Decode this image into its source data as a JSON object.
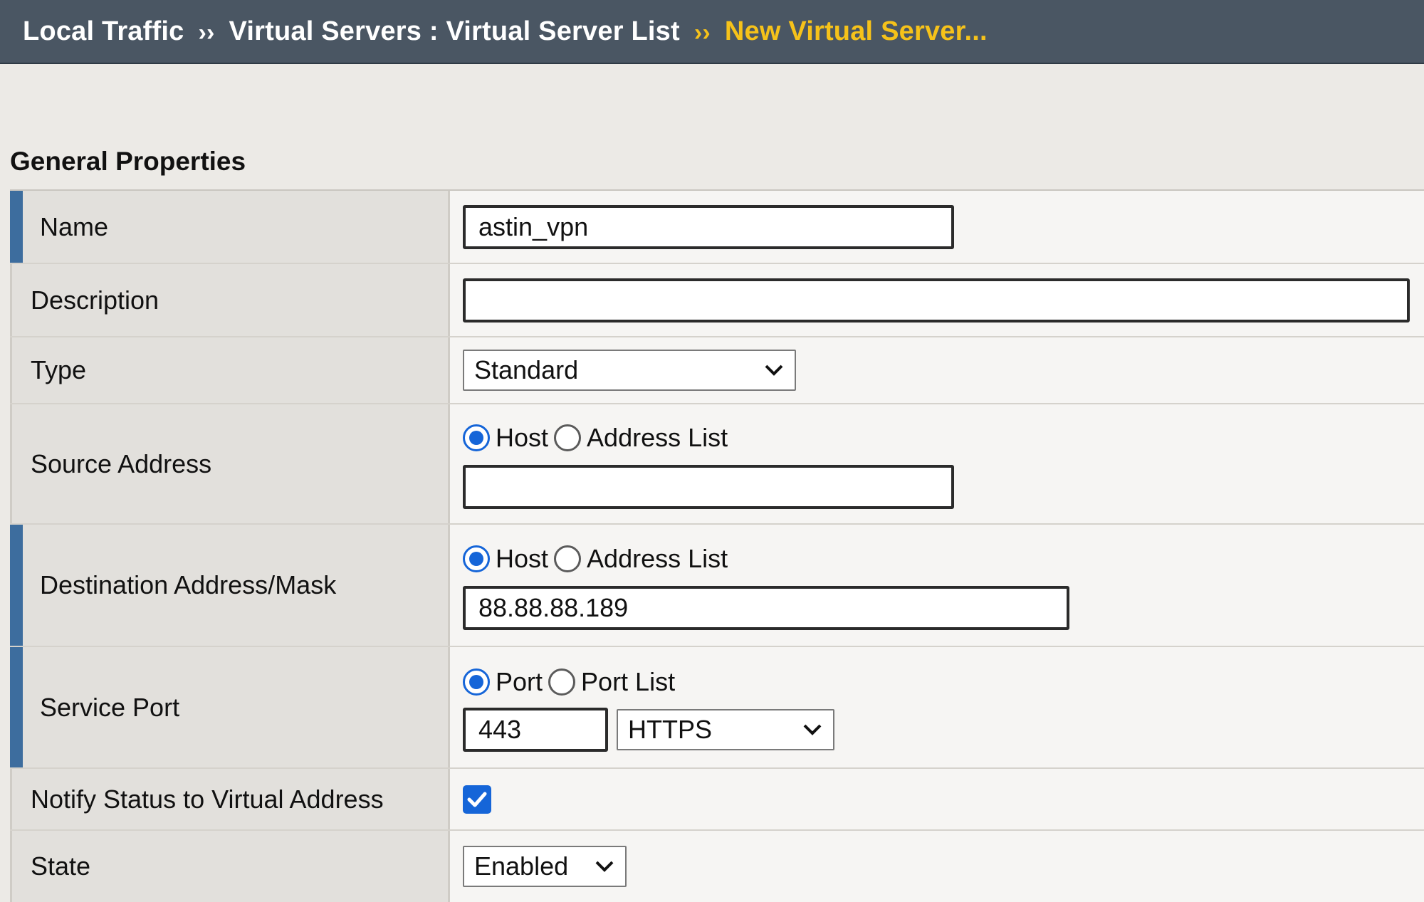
{
  "breadcrumb": {
    "root": "Local Traffic",
    "section": "Virtual Servers : Virtual Server List",
    "current": "New Virtual Server...",
    "separator": "››"
  },
  "section_title": "General Properties",
  "fields": {
    "name": {
      "label": "Name",
      "value": "astin_vpn"
    },
    "description": {
      "label": "Description",
      "value": ""
    },
    "type": {
      "label": "Type",
      "value": "Standard"
    },
    "source_address": {
      "label": "Source Address",
      "radio_host": "Host",
      "radio_list": "Address List",
      "selected": "Host",
      "value": ""
    },
    "destination": {
      "label": "Destination Address/Mask",
      "radio_host": "Host",
      "radio_list": "Address List",
      "selected": "Host",
      "value": "88.88.88.189"
    },
    "service_port": {
      "label": "Service Port",
      "radio_port": "Port",
      "radio_list": "Port List",
      "selected": "Port",
      "port_value": "443",
      "protocol": "HTTPS"
    },
    "notify": {
      "label": "Notify Status to Virtual Address",
      "checked": true
    },
    "state": {
      "label": "State",
      "value": "Enabled"
    }
  },
  "colors": {
    "header_bg": "#4a5663",
    "current_crumb": "#f6c21a",
    "required_marker": "#3d6d9e",
    "accent": "#1565d8"
  },
  "icons": {
    "dropdown": "chevron-down-icon",
    "checkmark": "checkmark-icon"
  }
}
